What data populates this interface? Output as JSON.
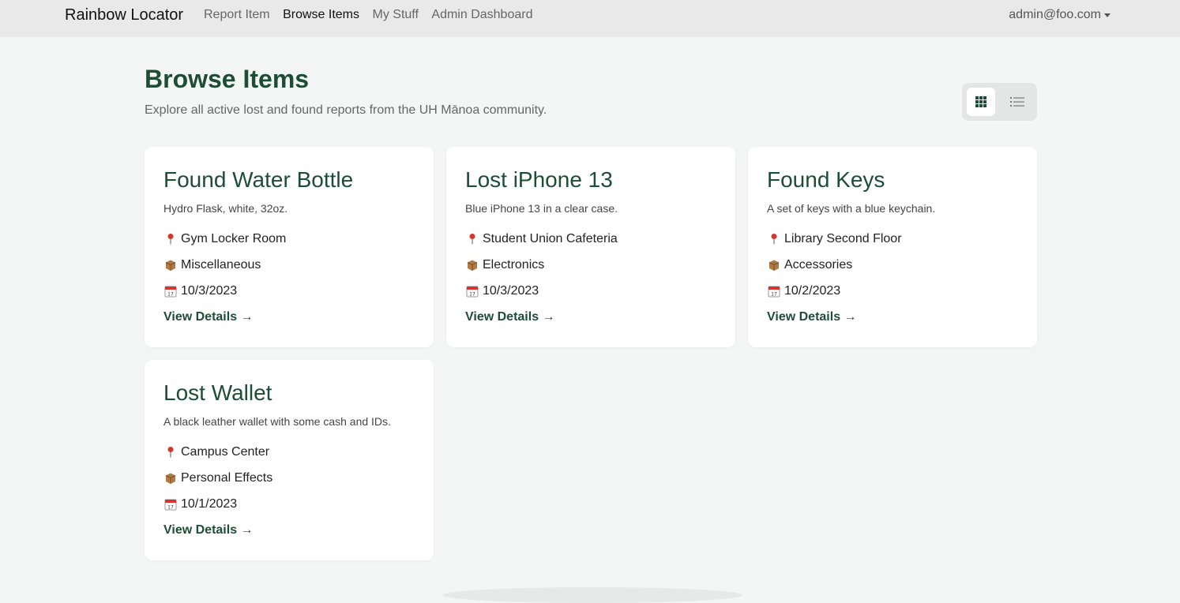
{
  "navbar": {
    "brand": "Rainbow Locator",
    "links": [
      {
        "label": "Report Item",
        "active": false
      },
      {
        "label": "Browse Items",
        "active": true
      },
      {
        "label": "My Stuff",
        "active": false
      },
      {
        "label": "Admin Dashboard",
        "active": false
      }
    ],
    "user_email": "admin@foo.com"
  },
  "header": {
    "title": "Browse Items",
    "subtitle": "Explore all active lost and found reports from the UH Mānoa community."
  },
  "view_toggle": {
    "selected": "grid",
    "options": [
      "grid-icon",
      "list-icon"
    ]
  },
  "items": [
    {
      "title": "Found Water Bottle",
      "description": "Hydro Flask, white, 32oz.",
      "location": "Gym Locker Room",
      "category": "Miscellaneous",
      "date": "10/3/2023",
      "link": "View Details →"
    },
    {
      "title": "Lost iPhone 13",
      "description": "Blue iPhone 13 in a clear case.",
      "location": "Student Union Cafeteria",
      "category": "Electronics",
      "date": "10/3/2023",
      "link": "View Details →"
    },
    {
      "title": "Found Keys",
      "description": "A set of keys with a blue keychain.",
      "location": "Library Second Floor",
      "category": "Accessories",
      "date": "10/2/2023",
      "link": "View Details →"
    },
    {
      "title": "Lost Wallet",
      "description": "A black leather wallet with some cash and IDs.",
      "location": "Campus Center",
      "category": "Personal Effects",
      "date": "10/1/2023",
      "link": "View Details →"
    }
  ],
  "icons": {
    "location": "pin-icon",
    "category": "package-icon",
    "date": "calendar-icon"
  },
  "colors": {
    "accent": "#1e4d36",
    "navbar_bg": "#e9e9e9",
    "page_bg": "#f4f6f5",
    "pin": "#d9342b",
    "package": "#9c6b3c"
  }
}
